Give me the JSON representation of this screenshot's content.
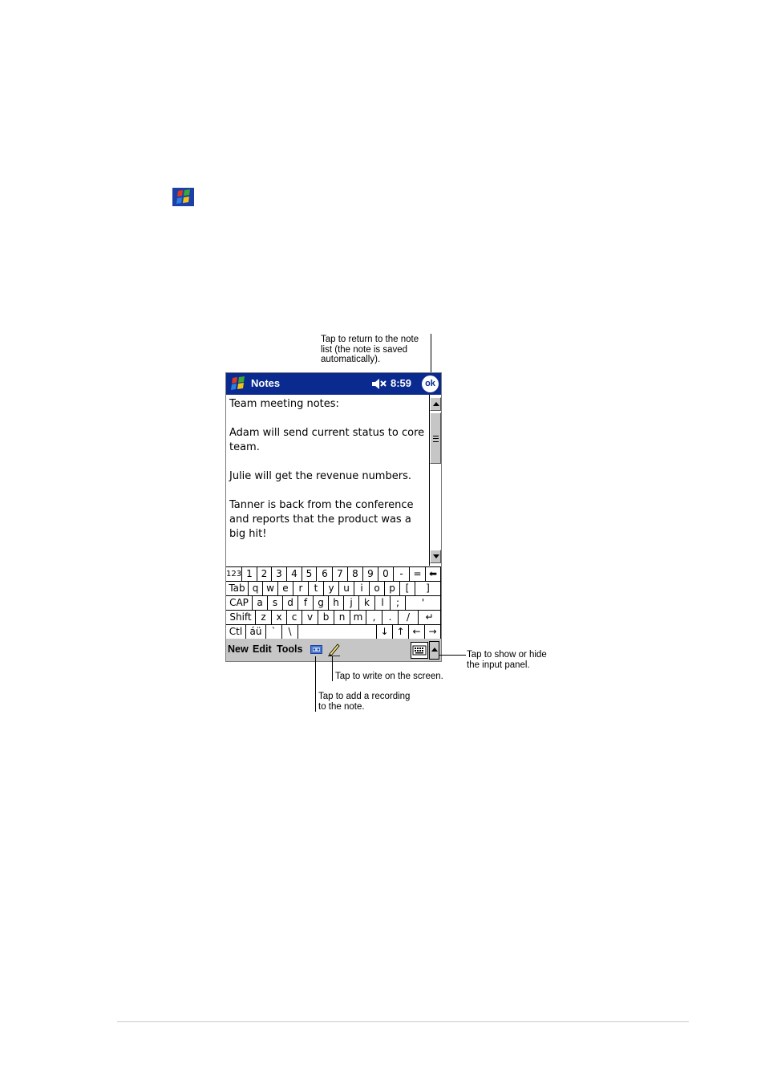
{
  "callouts": {
    "ok": "Tap to return to the note\nlist (the note is saved\nautomatically).",
    "input_panel": "Tap to show or hide\nthe input panel.",
    "write": "Tap to write on the screen.",
    "recording": "Tap to add a recording\nto the note."
  },
  "titlebar": {
    "title": "Notes",
    "time": "8:59",
    "ok": "ok"
  },
  "note": {
    "lines": [
      "Team meeting notes:",
      "",
      "Adam will send current status to core",
      "team.",
      "",
      "Julie will get the revenue numbers.",
      "",
      "Tanner is back from the conference",
      "and reports that the product was a",
      "big hit!"
    ]
  },
  "keyboard": {
    "rows": [
      [
        "123",
        "1",
        "2",
        "3",
        "4",
        "5",
        "6",
        "7",
        "8",
        "9",
        "0",
        "-",
        "=",
        "⬅"
      ],
      [
        "Tab",
        "q",
        "w",
        "e",
        "r",
        "t",
        "y",
        "u",
        "i",
        "o",
        "p",
        "[",
        "]"
      ],
      [
        "CAP",
        "a",
        "s",
        "d",
        "f",
        "g",
        "h",
        "j",
        "k",
        "l",
        ";",
        "'"
      ],
      [
        "Shift",
        "z",
        "x",
        "c",
        "v",
        "b",
        "n",
        "m",
        ",",
        ".",
        "/",
        "↵"
      ],
      [
        "Ctl",
        "áü",
        "`",
        "\\",
        "",
        "↓",
        "↑",
        "←",
        "→"
      ]
    ]
  },
  "menu": {
    "new": "New",
    "edit": "Edit",
    "tools": "Tools"
  },
  "icons": {
    "windows_flag": "windows-flag-icon",
    "speaker": "speaker-muted-icon",
    "recording": "recording-icon",
    "pen": "pen-icon",
    "keyboard": "keyboard-icon"
  },
  "colors": {
    "title_bar": "#0a2a8f",
    "menu_bar": "#c6c6c6"
  }
}
